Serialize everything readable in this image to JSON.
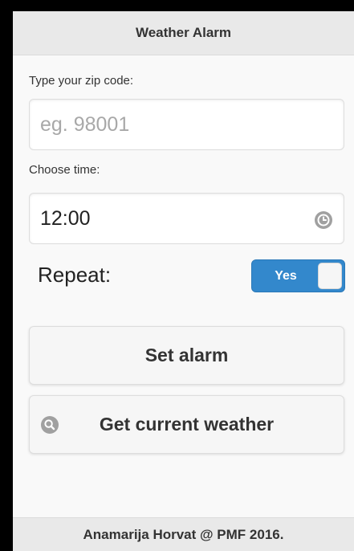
{
  "header": {
    "title": "Weather Alarm"
  },
  "zip": {
    "label": "Type your zip code:",
    "placeholder": "eg. 98001",
    "value": ""
  },
  "time": {
    "label": "Choose time:",
    "value": "12:00"
  },
  "repeat": {
    "label": "Repeat:",
    "toggle_text": "Yes",
    "enabled": true
  },
  "buttons": {
    "set_alarm": "Set alarm",
    "get_weather": "Get current weather"
  },
  "icons": {
    "time": "clock-icon",
    "weather": "search-icon"
  },
  "colors": {
    "accent": "#3388cc",
    "icon_grey": "#a0a0a0"
  },
  "footer": {
    "text": "Anamarija Horvat @ PMF 2016."
  }
}
